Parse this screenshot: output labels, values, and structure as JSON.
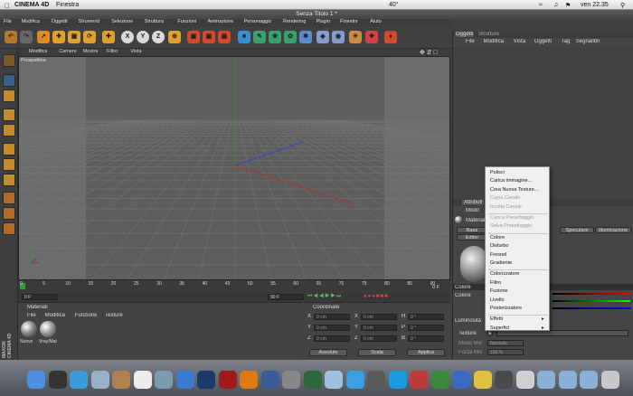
{
  "mac_menubar": {
    "apple": "",
    "app": "CINEMA 4D",
    "menu": "Finestra",
    "temp": "40°",
    "time": "ven 22.35"
  },
  "window": {
    "title": "Senza Titolo 1 *"
  },
  "menubar": [
    "File",
    "Modifica",
    "Oggetti",
    "Strumenti",
    "Selezione",
    "Struttura",
    "Funzioni",
    "Animazione",
    "Personaggio",
    "Rendering",
    "Plugin",
    "Finestre",
    "Aiuto"
  ],
  "toolbar": {
    "x_label": "X",
    "y_label": "Y",
    "z_label": "Z"
  },
  "viewport": {
    "menu": [
      "Modifica",
      "Camere",
      "Mostra",
      "Filtro",
      "Vista"
    ],
    "label": "Prospettiva"
  },
  "timeline": {
    "ticks": [
      "0",
      "5",
      "10",
      "15",
      "20",
      "25",
      "30",
      "35",
      "40",
      "45",
      "50",
      "55",
      "60",
      "65",
      "70",
      "75",
      "80",
      "85",
      "90"
    ],
    "end_label": "0 F",
    "start_field": "0 F",
    "end_field": "90 F"
  },
  "materials": {
    "title": "Materiali",
    "menu": [
      "File",
      "Modifica",
      "Funzione",
      "Texture"
    ],
    "items": [
      "Nuovo",
      "Vray/Mat"
    ]
  },
  "coordinates": {
    "title": "Coordinate",
    "rows": [
      {
        "axis": "X",
        "val": "0 cm",
        "axis2": "X",
        "val2": "0 cm",
        "axis3": "H",
        "val3": "0 °"
      },
      {
        "axis": "Y",
        "val": "0 cm",
        "axis2": "Y",
        "val2": "0 cm",
        "axis3": "P",
        "val3": "0 °"
      },
      {
        "axis": "Z",
        "val": "0 cm",
        "axis2": "Z",
        "val2": "0 cm",
        "axis3": "B",
        "val3": "0 °"
      }
    ],
    "mode1": "Assoluto",
    "mode2": "Scala",
    "apply": "Applica"
  },
  "objects_panel": {
    "tabs": [
      "Oggetti",
      "Strutture"
    ],
    "menu": [
      "File",
      "Modifica",
      "Vista",
      "Oggetti",
      "Tag",
      "Segnalibri"
    ]
  },
  "attributes_panel": {
    "title": "Attributi",
    "mode": "Modo",
    "material_label": "Materiale",
    "base": "Base",
    "editor": "Editor",
    "tab_specular": "Speculare",
    "tab_illum": "Illuminazione",
    "colors_header": "Colore",
    "color_label": "Colore",
    "lumin_label": "Luminosità",
    "texture_label": "Texture",
    "mode_mix": "Modo Mix",
    "mode_mix_val": "Normale",
    "force_mix": "Forza Mix",
    "force_mix_val": "100 %"
  },
  "context_menu": {
    "items": [
      {
        "label": "Pulisci",
        "enabled": true
      },
      {
        "label": "Carica Immagine...",
        "enabled": true
      },
      {
        "label": "Crea Nuova Texture...",
        "enabled": true
      },
      {
        "label": "Copia Canale",
        "enabled": false
      },
      {
        "label": "Incolla Canale",
        "enabled": false
      },
      {
        "sep": true
      },
      {
        "label": "Carica Presettaggio",
        "enabled": false
      },
      {
        "label": "Salva Presettaggio",
        "enabled": false
      },
      {
        "sep": true
      },
      {
        "label": "Colore",
        "enabled": true
      },
      {
        "label": "Disturbo",
        "enabled": true
      },
      {
        "label": "Fresnel",
        "enabled": true
      },
      {
        "label": "Gradiente",
        "enabled": true
      },
      {
        "sep": true
      },
      {
        "label": "Colorizzatore",
        "enabled": true
      },
      {
        "label": "Filtro",
        "enabled": true
      },
      {
        "label": "Fusione",
        "enabled": true
      },
      {
        "label": "Livello",
        "enabled": true
      },
      {
        "label": "Posterizzatore",
        "enabled": true
      },
      {
        "sep": true
      },
      {
        "label": "Effetti",
        "enabled": true
      },
      {
        "label": "Superfici",
        "enabled": true
      }
    ]
  },
  "side_brand": "MAXON CINEMA 4D"
}
